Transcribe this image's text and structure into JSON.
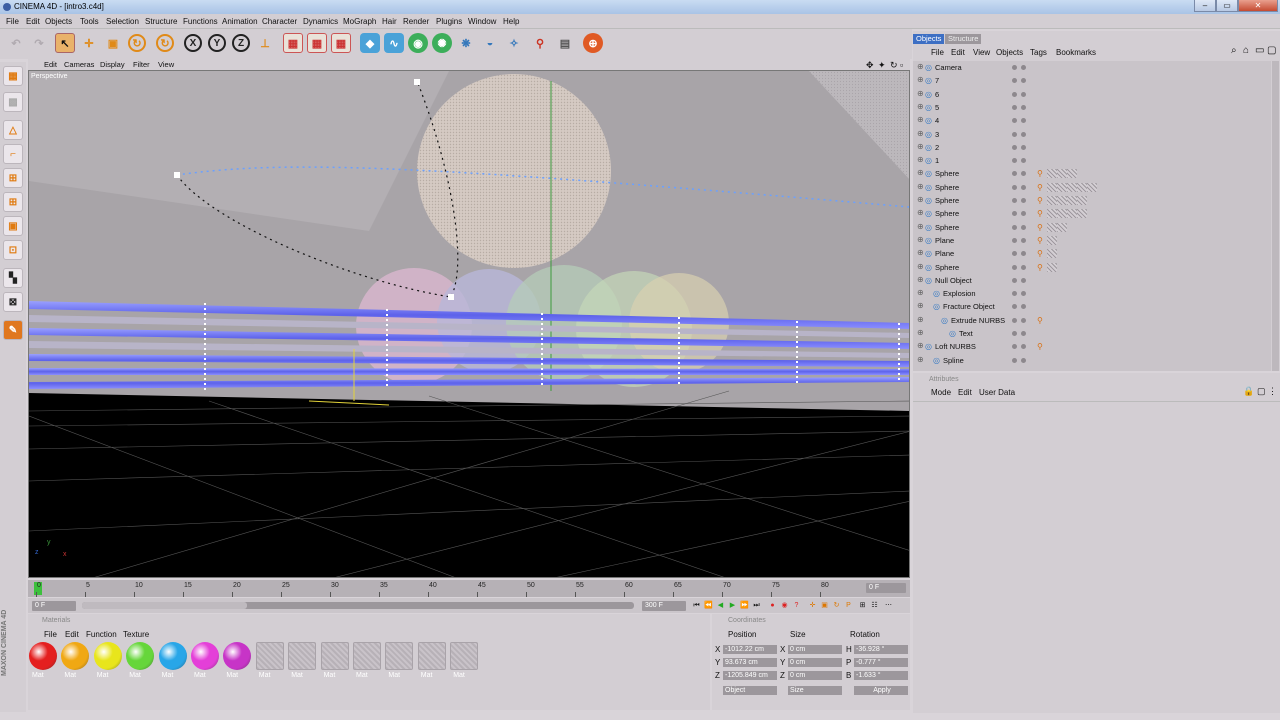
{
  "window": {
    "title": "CINEMA 4D - [intro3.c4d]",
    "controls": [
      "–",
      "▭",
      "✕"
    ]
  },
  "menu": [
    "File",
    "Edit",
    "Objects",
    "Tools",
    "Selection",
    "Structure",
    "Functions",
    "Animation",
    "Character",
    "Dynamics",
    "MoGraph",
    "Hair",
    "Render",
    "Plugins",
    "Window",
    "Help"
  ],
  "viewport": {
    "menu": [
      "Edit",
      "Cameras",
      "Display",
      "Filter",
      "View"
    ],
    "label": "Perspective",
    "axis": {
      "y": "y",
      "x": "x",
      "z": "z"
    }
  },
  "timeline": {
    "ticks": [
      "0",
      "5",
      "10",
      "15",
      "20",
      "25",
      "30",
      "35",
      "40",
      "45",
      "50",
      "55",
      "60",
      "65",
      "70",
      "75",
      "80"
    ],
    "current_frame": "0 F",
    "start_frame": "0 F",
    "end_frame": "300 F",
    "scrub_label": "0 F"
  },
  "materials": {
    "title": "Materials",
    "menu": [
      "File",
      "Edit",
      "Function",
      "Texture"
    ],
    "items": [
      {
        "label": "Mat",
        "color": "#e41f1f"
      },
      {
        "label": "Mat",
        "color": "#f0a813"
      },
      {
        "label": "Mat",
        "color": "#e8e51c"
      },
      {
        "label": "Mat",
        "color": "#66d63a"
      },
      {
        "label": "Mat",
        "color": "#28a6e8"
      },
      {
        "label": "Mat",
        "color": "#e43fd8"
      },
      {
        "label": "Mat",
        "color": "#c734c7"
      },
      {
        "label": "Mat",
        "color": ""
      },
      {
        "label": "Mat",
        "color": ""
      },
      {
        "label": "Mat",
        "color": ""
      },
      {
        "label": "Mat",
        "color": ""
      },
      {
        "label": "Mat",
        "color": ""
      },
      {
        "label": "Mat",
        "color": ""
      },
      {
        "label": "Mat",
        "color": ""
      }
    ]
  },
  "coordinates": {
    "title": "Coordinates",
    "headers": [
      "Position",
      "Size",
      "Rotation"
    ],
    "rows": [
      {
        "axis": "X",
        "position": "-1012.22 cm",
        "size_axis": "X",
        "size": "0 cm",
        "rot_axis": "H",
        "rotation": "-36.928 °"
      },
      {
        "axis": "Y",
        "position": "93.673 cm",
        "size_axis": "Y",
        "size": "0 cm",
        "rot_axis": "P",
        "rotation": "-0.777 °"
      },
      {
        "axis": "Z",
        "position": "-1205.849 cm",
        "size_axis": "Z",
        "size": "0 cm",
        "rot_axis": "B",
        "rotation": "-1.633 °"
      }
    ],
    "mode_select": "Object",
    "size_select": "Size",
    "apply_label": "Apply"
  },
  "objects_panel": {
    "tabs": [
      "Objects",
      "Structure"
    ],
    "menu": [
      "File",
      "Edit",
      "View",
      "Objects",
      "Tags",
      "Bookmarks"
    ],
    "items": [
      {
        "name": "Camera",
        "indent": 1
      },
      {
        "name": "7",
        "indent": 1
      },
      {
        "name": "6",
        "indent": 1
      },
      {
        "name": "5",
        "indent": 1
      },
      {
        "name": "4",
        "indent": 1
      },
      {
        "name": "3",
        "indent": 1
      },
      {
        "name": "2",
        "indent": 1
      },
      {
        "name": "1",
        "indent": 1
      },
      {
        "name": "Sphere",
        "indent": 1
      },
      {
        "name": "Sphere",
        "indent": 1
      },
      {
        "name": "Sphere",
        "indent": 1
      },
      {
        "name": "Sphere",
        "indent": 1
      },
      {
        "name": "Sphere",
        "indent": 1
      },
      {
        "name": "Plane",
        "indent": 1
      },
      {
        "name": "Plane",
        "indent": 1
      },
      {
        "name": "Sphere",
        "indent": 1
      },
      {
        "name": "Null Object",
        "indent": 1
      },
      {
        "name": "Explosion",
        "indent": 2
      },
      {
        "name": "Fracture Object",
        "indent": 2
      },
      {
        "name": "Extrude NURBS",
        "indent": 3
      },
      {
        "name": "Text",
        "indent": 4
      },
      {
        "name": "Loft NURBS",
        "indent": 1
      },
      {
        "name": "Spline",
        "indent": 2
      }
    ]
  },
  "attributes_panel": {
    "title": "Attributes",
    "menu": [
      "Mode",
      "Edit",
      "User Data"
    ]
  },
  "brand": "MAXON CINEMA 4D"
}
